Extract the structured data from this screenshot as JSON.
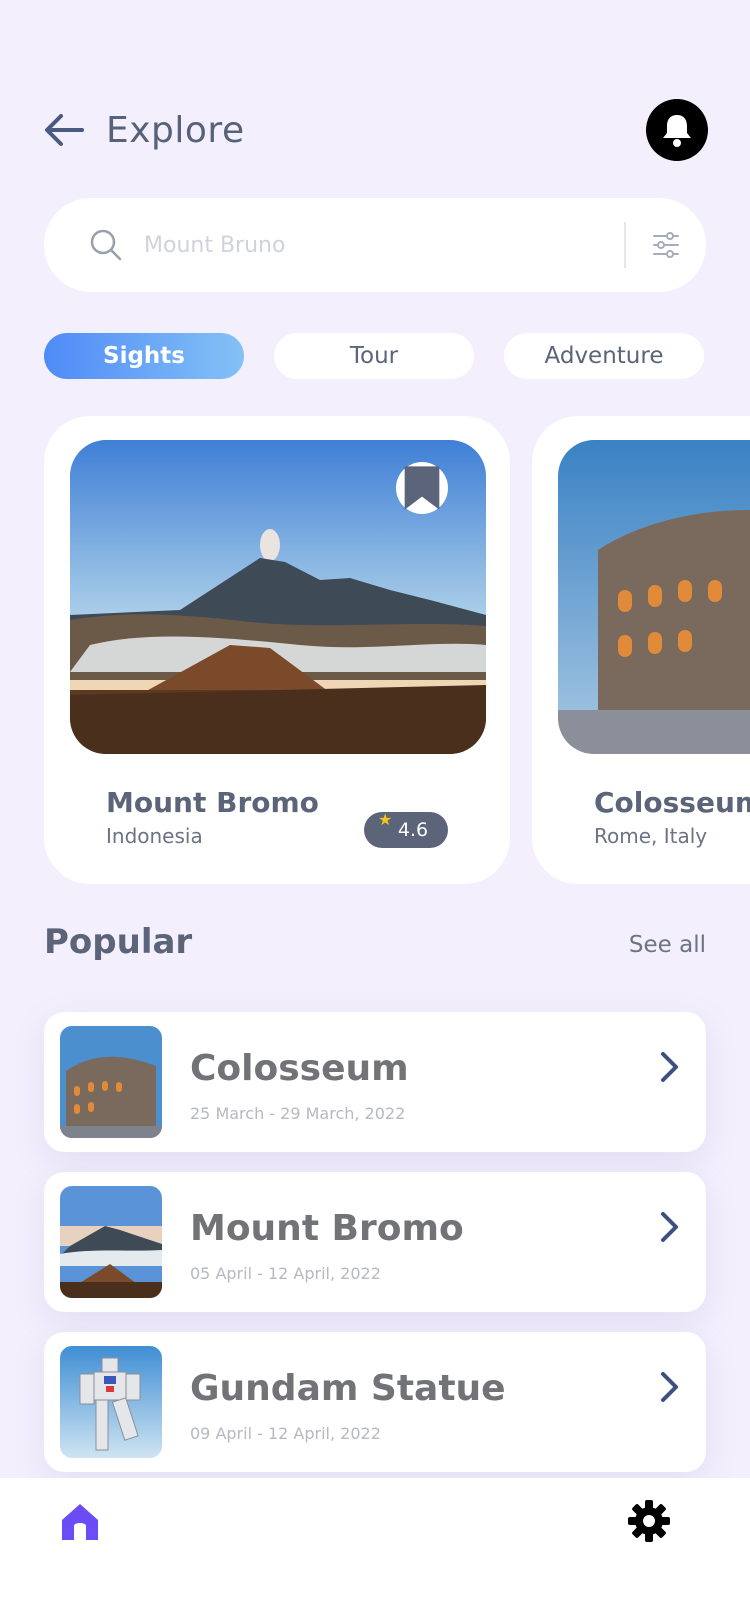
{
  "header": {
    "title": "Explore",
    "back_icon": "arrow-left-icon",
    "notification_icon": "bell-icon"
  },
  "search": {
    "placeholder": "Mount Bruno",
    "value": "",
    "search_icon": "search-icon",
    "filter_icon": "sliders-icon"
  },
  "tabs": [
    {
      "label": "Sights",
      "active": true
    },
    {
      "label": "Tour",
      "active": false
    },
    {
      "label": "Adventure",
      "active": false
    }
  ],
  "featured": [
    {
      "name": "Mount Bromo",
      "location": "Indonesia",
      "rating": "4.6",
      "bookmarked": true
    },
    {
      "name": "Colosseum",
      "location": "Rome, Italy"
    }
  ],
  "popular": {
    "title": "Popular",
    "see_all": "See all",
    "items": [
      {
        "title": "Colosseum",
        "dates": "25 March - 29 March, 2022"
      },
      {
        "title": "Mount Bromo",
        "dates": "05 April  - 12 April, 2022"
      },
      {
        "title": "Gundam Statue",
        "dates": "09 April  - 12 April, 2022"
      }
    ]
  },
  "nav": {
    "home_icon": "home-icon",
    "settings_icon": "gear-icon"
  },
  "colors": {
    "background": "#f3effc",
    "accent_start": "#4f8bf7",
    "accent_end": "#84c1f6",
    "text": "#5b6478",
    "home_icon": "#6b4cf6",
    "star": "#f5c518"
  }
}
